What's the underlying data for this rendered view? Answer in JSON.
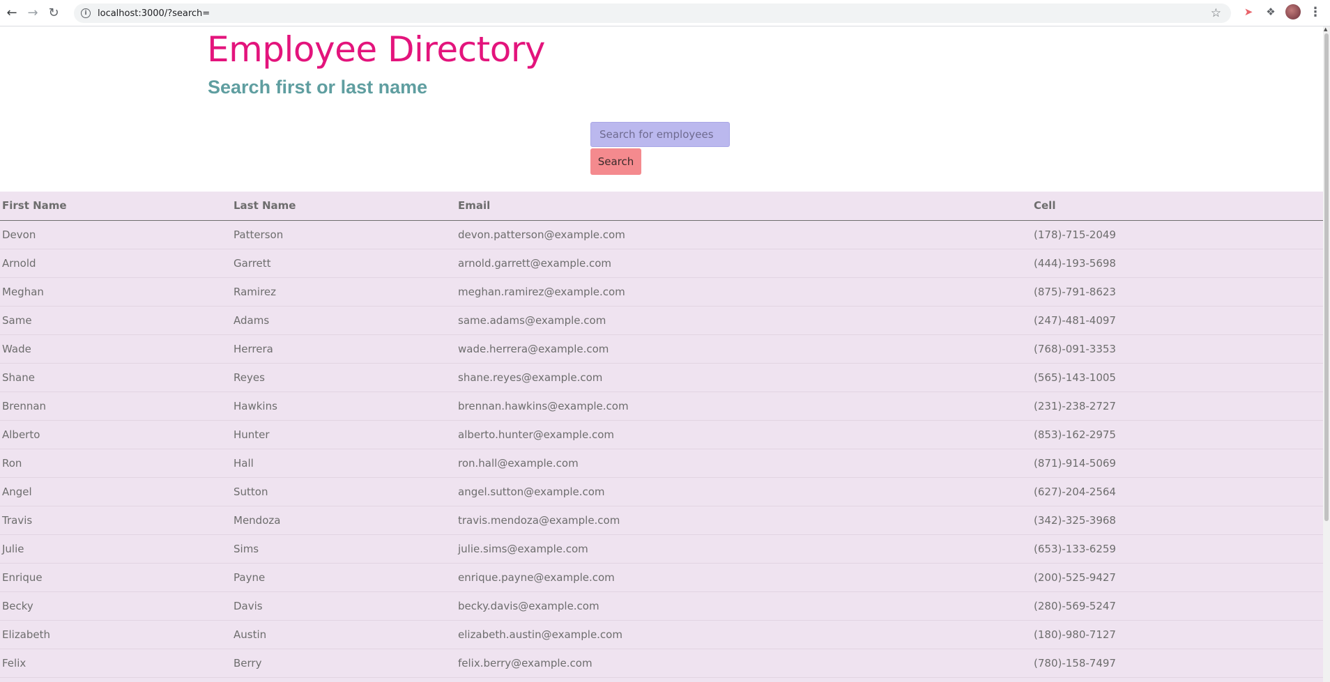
{
  "browser": {
    "url": "localhost:3000/?search="
  },
  "header": {
    "title": "Employee Directory",
    "subtitle": "Search first or last name"
  },
  "search": {
    "placeholder": "Search for employees",
    "value": "",
    "button_label": "Search"
  },
  "table": {
    "columns": [
      "First Name",
      "Last Name",
      "Email",
      "Cell"
    ],
    "rows": [
      [
        "Devon",
        "Patterson",
        "devon.patterson@example.com",
        "(178)-715-2049"
      ],
      [
        "Arnold",
        "Garrett",
        "arnold.garrett@example.com",
        "(444)-193-5698"
      ],
      [
        "Meghan",
        "Ramirez",
        "meghan.ramirez@example.com",
        "(875)-791-8623"
      ],
      [
        "Same",
        "Adams",
        "same.adams@example.com",
        "(247)-481-4097"
      ],
      [
        "Wade",
        "Herrera",
        "wade.herrera@example.com",
        "(768)-091-3353"
      ],
      [
        "Shane",
        "Reyes",
        "shane.reyes@example.com",
        "(565)-143-1005"
      ],
      [
        "Brennan",
        "Hawkins",
        "brennan.hawkins@example.com",
        "(231)-238-2727"
      ],
      [
        "Alberto",
        "Hunter",
        "alberto.hunter@example.com",
        "(853)-162-2975"
      ],
      [
        "Ron",
        "Hall",
        "ron.hall@example.com",
        "(871)-914-5069"
      ],
      [
        "Angel",
        "Sutton",
        "angel.sutton@example.com",
        "(627)-204-2564"
      ],
      [
        "Travis",
        "Mendoza",
        "travis.mendoza@example.com",
        "(342)-325-3968"
      ],
      [
        "Julie",
        "Sims",
        "julie.sims@example.com",
        "(653)-133-6259"
      ],
      [
        "Enrique",
        "Payne",
        "enrique.payne@example.com",
        "(200)-525-9427"
      ],
      [
        "Becky",
        "Davis",
        "becky.davis@example.com",
        "(280)-569-5247"
      ],
      [
        "Elizabeth",
        "Austin",
        "elizabeth.austin@example.com",
        "(180)-980-7127"
      ],
      [
        "Felix",
        "Berry",
        "felix.berry@example.com",
        "(780)-158-7497"
      ]
    ]
  },
  "colors": {
    "title": "#e3147c",
    "subtitle": "#5f9ea0",
    "search_input_bg": "#bbb8ee",
    "search_button_bg": "#f48a8e",
    "table_bg": "#efe3f0"
  },
  "icons": {
    "back": "arrow-left-icon",
    "forward": "arrow-right-icon",
    "reload": "reload-icon",
    "info": "info-icon",
    "bookmark": "star-icon",
    "extension": "extension-icon",
    "extensions_menu": "puzzle-icon",
    "profile": "avatar",
    "menu": "more-vert-icon"
  }
}
